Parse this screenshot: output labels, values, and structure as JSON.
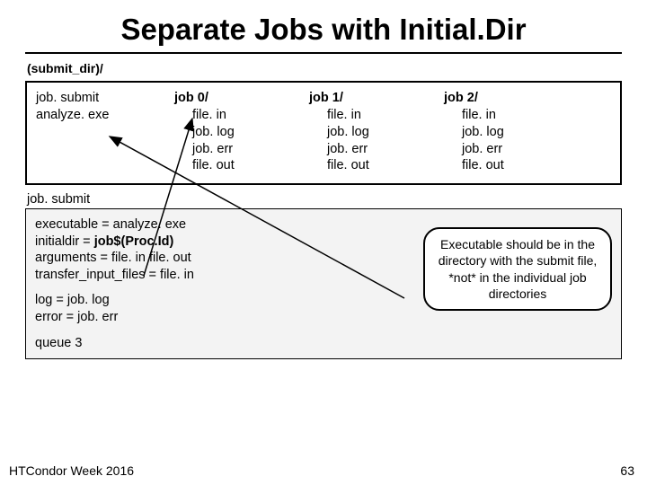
{
  "title": "Separate Jobs with Initial.Dir",
  "subdir_label": "(submit_dir)/",
  "leftcol": {
    "line1": "job. submit",
    "line2": "analyze. exe"
  },
  "jobs": [
    {
      "head": "job 0/",
      "files": [
        "file. in",
        "job. log",
        "job. err",
        "file. out"
      ]
    },
    {
      "head": "job 1/",
      "files": [
        "file. in",
        "job. log",
        "job. err",
        "file. out"
      ]
    },
    {
      "head": "job 2/",
      "files": [
        "file. in",
        "job. log",
        "job. err",
        "file. out"
      ]
    }
  ],
  "submit_label": "job. submit",
  "submit_block1": [
    {
      "key": "executable = analyze. exe",
      "bold_val": false
    },
    {
      "key": "initialdir = ",
      "val": "job$(Proc.Id)",
      "bold_val": true
    },
    {
      "key": "arguments = file. in file. out",
      "bold_val": false
    },
    {
      "key": "transfer_input_files = file. in",
      "bold_val": false
    }
  ],
  "submit_block2": [
    {
      "key": "log = job. log"
    },
    {
      "key": "error = job. err"
    }
  ],
  "submit_block3": [
    {
      "key": "queue 3"
    }
  ],
  "callout": "Executable should be in the directory with the submit file, *not* in the individual job directories",
  "footer_left": "HTCondor Week 2016",
  "footer_right": "63"
}
